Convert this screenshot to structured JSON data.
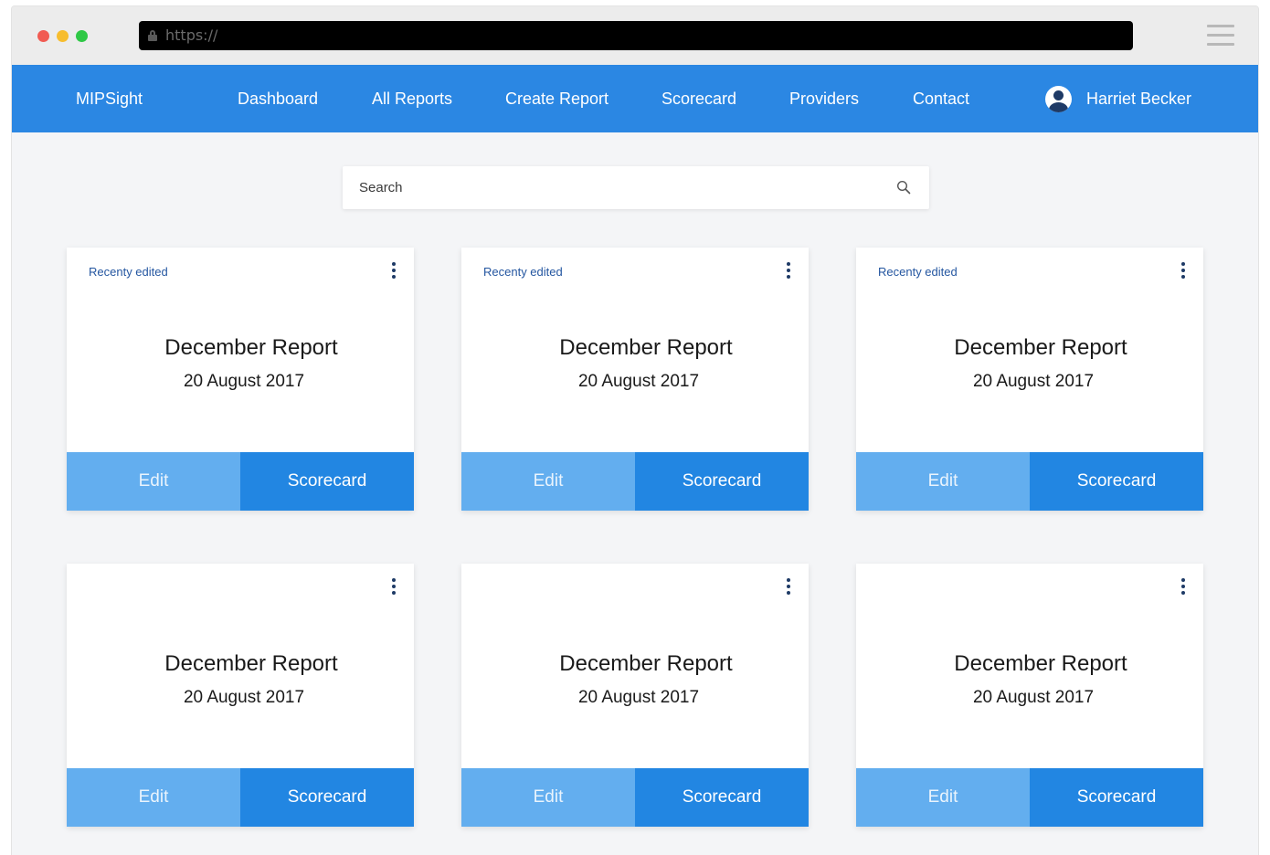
{
  "browser": {
    "url": "https://"
  },
  "nav": {
    "brand": "MIPSight",
    "items": [
      {
        "label": "Dashboard"
      },
      {
        "label": "All Reports"
      },
      {
        "label": "Create Report"
      },
      {
        "label": "Scorecard"
      },
      {
        "label": "Providers"
      },
      {
        "label": "Contact"
      }
    ],
    "user_name": "Harriet Becker"
  },
  "search": {
    "placeholder": "Search"
  },
  "cards": [
    {
      "tag": "Recenty edited",
      "title": "December Report",
      "date": "20 August 2017",
      "edit_label": "Edit",
      "scorecard_label": "Scorecard"
    },
    {
      "tag": "Recenty edited",
      "title": "December Report",
      "date": "20 August 2017",
      "edit_label": "Edit",
      "scorecard_label": "Scorecard"
    },
    {
      "tag": "Recenty edited",
      "title": "December Report",
      "date": "20 August 2017",
      "edit_label": "Edit",
      "scorecard_label": "Scorecard"
    },
    {
      "tag": "",
      "title": "December Report",
      "date": "20 August 2017",
      "edit_label": "Edit",
      "scorecard_label": "Scorecard"
    },
    {
      "tag": "",
      "title": "December Report",
      "date": "20 August 2017",
      "edit_label": "Edit",
      "scorecard_label": "Scorecard"
    },
    {
      "tag": "",
      "title": "December Report",
      "date": "20 August 2017",
      "edit_label": "Edit",
      "scorecard_label": "Scorecard"
    }
  ],
  "colors": {
    "nav_bg": "#2b87e3",
    "edit_button": "#63aeef",
    "scorecard_button": "#2286e2",
    "tag_text": "#2456a0"
  }
}
